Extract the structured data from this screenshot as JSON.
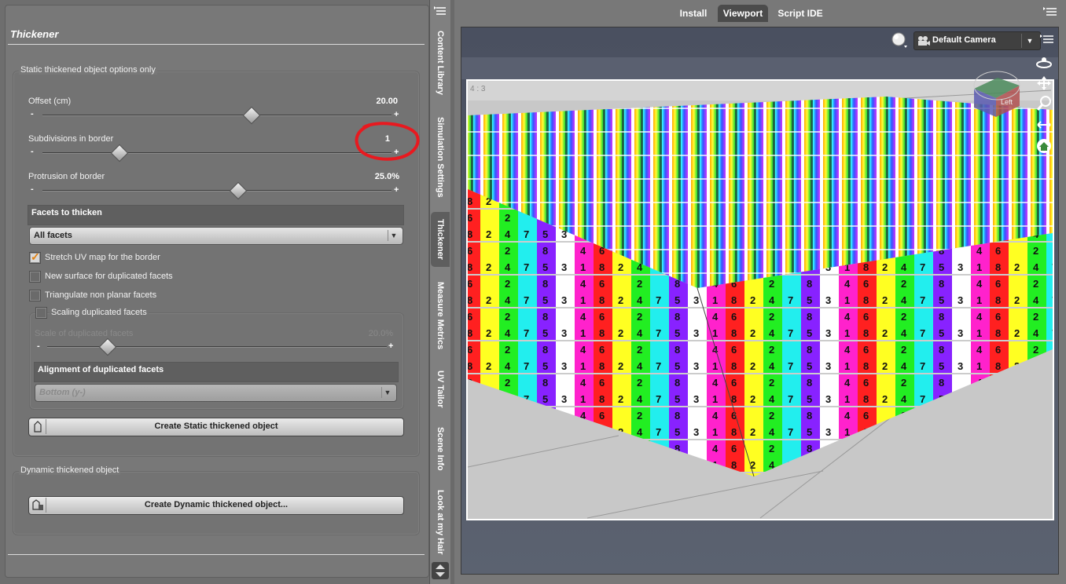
{
  "thickener": {
    "title": "Thickener",
    "static_group_label": "Static thickened object options only",
    "offset": {
      "label": "Offset (cm)",
      "value": "20.00",
      "level": 0.6
    },
    "subdivisions": {
      "label": "Subdivisions in border",
      "value": "1",
      "level": 0.22
    },
    "protrusion": {
      "label": "Protrusion of border",
      "value": "25.0%",
      "level": 0.56
    },
    "facets_head": "Facets to thicken",
    "facets_value": "All facets",
    "stretch_uv": "Stretch UV map for the border",
    "new_surface": "New surface for duplicated facets",
    "triangulate": "Triangulate non planar facets",
    "scaling": "Scaling duplicated facets",
    "scale_label": "Scale of duplicated facets",
    "scale_value": "20.0%",
    "alignment_head": "Alignment of duplicated facets",
    "alignment_value": "Bottom (y-)",
    "create_static": "Create Static thickened object",
    "dynamic_group_label": "Dynamic thickened object",
    "create_dynamic": "Create Dynamic thickened object...",
    "minus": "-",
    "plus": "+"
  },
  "side_tabs": [
    "Content Library",
    "Simulation Settings",
    "Thickener",
    "Measure Metrics",
    "UV Tailor",
    "Scene Info",
    "Look at my Hair"
  ],
  "right_tabs": [
    "Install",
    "Viewport",
    "Script IDE"
  ],
  "viewport": {
    "camera": "Default Camera",
    "aspect": "4 : 3",
    "cube_left": "Left"
  },
  "colors": {
    "highlight_circle": "#e8191f",
    "check_accent": "#e08010"
  },
  "icons": {
    "panel_menu": "menu-icon",
    "camera": "camera-icon",
    "render_sphere": "render-sphere-icon",
    "orbit": "orbit-icon",
    "pan": "pan-icon",
    "zoom": "zoom-icon",
    "home": "home-icon"
  }
}
